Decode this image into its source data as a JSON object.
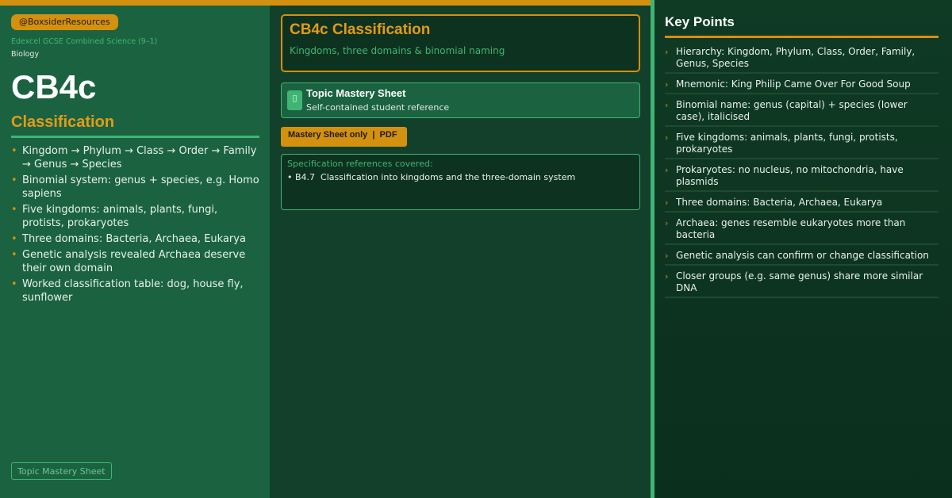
{
  "colors": {
    "accent": "#d4900f",
    "green": "#3fb574",
    "panel": "#1b6340",
    "dark": "#12402a"
  },
  "left": {
    "handle": "@BoxsiderResources",
    "course": "Edexcel GCSE Combined Science (9–1)",
    "subject": "Biology",
    "code": "CB4c",
    "title": "Classification",
    "bullets": [
      "Kingdom → Phylum → Class → Order → Family → Genus → Species",
      "Binomial system: genus + species, e.g. Homo sapiens",
      "Five kingdoms: animals, plants, fungi, protists, prokaryotes",
      "Three domains: Bacteria, Archaea, Eukarya",
      "Genetic analysis revealed Archaea deserve their own domain",
      "Worked classification table: dog, house fly, sunflower"
    ],
    "footer_tag": "Topic Mastery Sheet"
  },
  "middle": {
    "header_title": "CB4c Classification",
    "header_subtitle": "Kingdoms, three domains & binomial naming",
    "sheet_icon": "document-icon",
    "sheet_title": "Topic Mastery Sheet",
    "sheet_subtitle": "Self-contained student reference",
    "pdf_button": "Mastery Sheet only  |  PDF",
    "spec_label": "Specification references covered:",
    "spec_items": [
      "• B4.7  Classification into kingdoms and the three-domain system"
    ]
  },
  "right": {
    "title": "Key Points",
    "points": [
      "Hierarchy: Kingdom, Phylum, Class, Order, Family, Genus, Species",
      "Mnemonic: King Philip Came Over For Good Soup",
      "Binomial name: genus (capital) + species (lower case), italicised",
      "Five kingdoms: animals, plants, fungi, protists, prokaryotes",
      "Prokaryotes: no nucleus, no mitochondria, have plasmids",
      "Three domains: Bacteria, Archaea, Eukarya",
      "Archaea: genes resemble eukaryotes more than bacteria",
      "Genetic analysis can confirm or change classification",
      "Closer groups (e.g. same genus) share more similar DNA"
    ]
  }
}
